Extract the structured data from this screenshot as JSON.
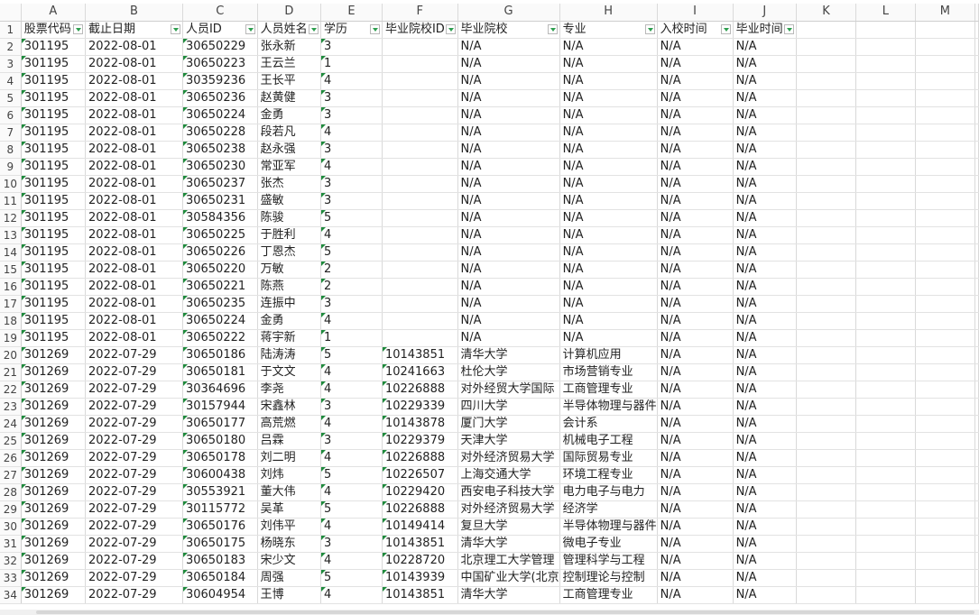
{
  "columns": [
    "A",
    "B",
    "C",
    "D",
    "E",
    "F",
    "G",
    "H",
    "I",
    "J",
    "K",
    "L",
    "M"
  ],
  "headers": [
    "股票代码",
    "截止日期",
    "人员ID",
    "人员姓名",
    "学历",
    "毕业院校ID",
    "毕业院校",
    "专业",
    "入校时间",
    "毕业时间"
  ],
  "rows": [
    [
      "301195",
      "2022-08-01",
      "30650229",
      "张永新",
      "3",
      "",
      "N/A",
      "N/A",
      "N/A",
      "N/A"
    ],
    [
      "301195",
      "2022-08-01",
      "30650223",
      "王云兰",
      "1",
      "",
      "N/A",
      "N/A",
      "N/A",
      "N/A"
    ],
    [
      "301195",
      "2022-08-01",
      "30359236",
      "王长平",
      "4",
      "",
      "N/A",
      "N/A",
      "N/A",
      "N/A"
    ],
    [
      "301195",
      "2022-08-01",
      "30650236",
      "赵黄健",
      "3",
      "",
      "N/A",
      "N/A",
      "N/A",
      "N/A"
    ],
    [
      "301195",
      "2022-08-01",
      "30650224",
      "金勇",
      "3",
      "",
      "N/A",
      "N/A",
      "N/A",
      "N/A"
    ],
    [
      "301195",
      "2022-08-01",
      "30650228",
      "段若凡",
      "4",
      "",
      "N/A",
      "N/A",
      "N/A",
      "N/A"
    ],
    [
      "301195",
      "2022-08-01",
      "30650238",
      "赵永强",
      "3",
      "",
      "N/A",
      "N/A",
      "N/A",
      "N/A"
    ],
    [
      "301195",
      "2022-08-01",
      "30650230",
      "常亚军",
      "4",
      "",
      "N/A",
      "N/A",
      "N/A",
      "N/A"
    ],
    [
      "301195",
      "2022-08-01",
      "30650237",
      "张杰",
      "3",
      "",
      "N/A",
      "N/A",
      "N/A",
      "N/A"
    ],
    [
      "301195",
      "2022-08-01",
      "30650231",
      "盛敏",
      "3",
      "",
      "N/A",
      "N/A",
      "N/A",
      "N/A"
    ],
    [
      "301195",
      "2022-08-01",
      "30584356",
      "陈骏",
      "5",
      "",
      "N/A",
      "N/A",
      "N/A",
      "N/A"
    ],
    [
      "301195",
      "2022-08-01",
      "30650225",
      "于胜利",
      "4",
      "",
      "N/A",
      "N/A",
      "N/A",
      "N/A"
    ],
    [
      "301195",
      "2022-08-01",
      "30650226",
      "丁恩杰",
      "5",
      "",
      "N/A",
      "N/A",
      "N/A",
      "N/A"
    ],
    [
      "301195",
      "2022-08-01",
      "30650220",
      "万敏",
      "2",
      "",
      "N/A",
      "N/A",
      "N/A",
      "N/A"
    ],
    [
      "301195",
      "2022-08-01",
      "30650221",
      "陈燕",
      "2",
      "",
      "N/A",
      "N/A",
      "N/A",
      "N/A"
    ],
    [
      "301195",
      "2022-08-01",
      "30650235",
      "连振中",
      "3",
      "",
      "N/A",
      "N/A",
      "N/A",
      "N/A"
    ],
    [
      "301195",
      "2022-08-01",
      "30650224",
      "金勇",
      "4",
      "",
      "N/A",
      "N/A",
      "N/A",
      "N/A"
    ],
    [
      "301195",
      "2022-08-01",
      "30650222",
      "蒋宇新",
      "1",
      "",
      "N/A",
      "N/A",
      "N/A",
      "N/A"
    ],
    [
      "301269",
      "2022-07-29",
      "30650186",
      "陆涛涛",
      "5",
      "10143851",
      "清华大学",
      "计算机应用",
      "N/A",
      "N/A"
    ],
    [
      "301269",
      "2022-07-29",
      "30650181",
      "于文文",
      "4",
      "10241663",
      "杜伦大学",
      "市场营销专业",
      "N/A",
      "N/A"
    ],
    [
      "301269",
      "2022-07-29",
      "30364696",
      "李尧",
      "4",
      "10226888",
      "对外经贸大学国际",
      "工商管理专业",
      "N/A",
      "N/A"
    ],
    [
      "301269",
      "2022-07-29",
      "30157944",
      "宋鑫林",
      "3",
      "10229339",
      "四川大学",
      "半导体物理与器件",
      "N/A",
      "N/A"
    ],
    [
      "301269",
      "2022-07-29",
      "30650177",
      "高荒燃",
      "4",
      "10143878",
      "厦门大学",
      "会计系",
      "N/A",
      "N/A"
    ],
    [
      "301269",
      "2022-07-29",
      "30650180",
      "吕霖",
      "3",
      "10229379",
      "天津大学",
      "机械电子工程",
      "N/A",
      "N/A"
    ],
    [
      "301269",
      "2022-07-29",
      "30650178",
      "刘二明",
      "4",
      "10226888",
      "对外经济贸易大学",
      "国际贸易专业",
      "N/A",
      "N/A"
    ],
    [
      "301269",
      "2022-07-29",
      "30600438",
      "刘炜",
      "5",
      "10226507",
      "上海交通大学",
      "环境工程专业",
      "N/A",
      "N/A"
    ],
    [
      "301269",
      "2022-07-29",
      "30553921",
      "董大伟",
      "4",
      "10229420",
      "西安电子科技大学",
      "电力电子与电力",
      "N/A",
      "N/A"
    ],
    [
      "301269",
      "2022-07-29",
      "30115772",
      "吴革",
      "5",
      "10226888",
      "对外经济贸易大学",
      "经济学",
      "N/A",
      "N/A"
    ],
    [
      "301269",
      "2022-07-29",
      "30650176",
      "刘伟平",
      "4",
      "10149414",
      "复旦大学",
      "半导体物理与器件",
      "N/A",
      "N/A"
    ],
    [
      "301269",
      "2022-07-29",
      "30650175",
      "杨晓东",
      "3",
      "10143851",
      "清华大学",
      "微电子专业",
      "N/A",
      "N/A"
    ],
    [
      "301269",
      "2022-07-29",
      "30650183",
      "宋少文",
      "4",
      "10228720",
      "北京理工大学管理",
      "管理科学与工程",
      "N/A",
      "N/A"
    ],
    [
      "301269",
      "2022-07-29",
      "30650184",
      "周强",
      "5",
      "10143939",
      "中国矿业大学(北京",
      "控制理论与控制",
      "N/A",
      "N/A"
    ],
    [
      "301269",
      "2022-07-29",
      "30604954",
      "王博",
      "4",
      "10143851",
      "清华大学",
      "工商管理专业",
      "N/A",
      "N/A"
    ]
  ]
}
